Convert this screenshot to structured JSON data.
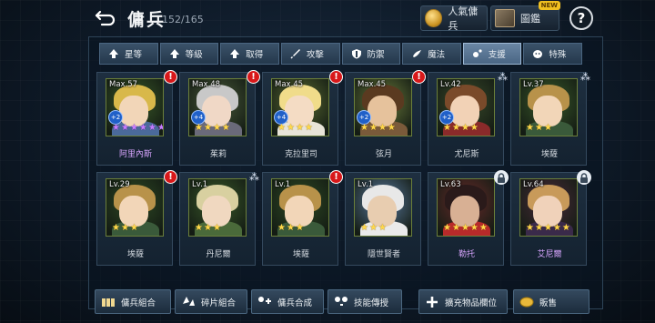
{
  "header": {
    "title": "傭兵",
    "count": "152/165",
    "popular_label": "人氣傭兵",
    "dex_label": "圖鑑",
    "new_badge": "NEW",
    "help_label": "?"
  },
  "tabs": [
    {
      "label": "星等",
      "icon": "arrow-up-icon",
      "active": false
    },
    {
      "label": "等級",
      "icon": "arrow-up-icon",
      "active": false
    },
    {
      "label": "取得",
      "icon": "arrow-up-icon",
      "active": false
    },
    {
      "label": "攻擊",
      "icon": "sword-icon",
      "active": false
    },
    {
      "label": "防禦",
      "icon": "shield-icon",
      "active": false
    },
    {
      "label": "魔法",
      "icon": "magic-icon",
      "active": false
    },
    {
      "label": "支援",
      "icon": "support-icon",
      "active": true
    },
    {
      "label": "特殊",
      "icon": "special-icon",
      "active": false
    }
  ],
  "mercenaries": [
    {
      "level": "Max.57",
      "name": "阿里內斯",
      "plus": "+2",
      "stars": 6,
      "star_color": "purple",
      "hero": true,
      "badge": "alert",
      "colors": {
        "bg": "#3a5a28",
        "hair": "#d8b84a",
        "skin": "#f2d6b8",
        "cloth": "#4a6a9a"
      }
    },
    {
      "level": "Max.48",
      "name": "茱莉",
      "plus": "+4",
      "stars": 4,
      "star_color": "gold",
      "hero": false,
      "badge": "alert",
      "colors": {
        "bg": "#4a5a3a",
        "hair": "#c8c8c8",
        "skin": "#f0d8c6",
        "cloth": "#6a6a7a"
      }
    },
    {
      "level": "Max.45",
      "name": "克拉里司",
      "plus": "+4",
      "stars": 4,
      "star_color": "gold",
      "hero": false,
      "badge": "alert",
      "colors": {
        "bg": "#5a6a32",
        "hair": "#f0dc8a",
        "skin": "#f4dcc4",
        "cloth": "#e8e4d8"
      }
    },
    {
      "level": "Max.45",
      "name": "弦月",
      "plus": "+2",
      "stars": 4,
      "star_color": "gold",
      "hero": false,
      "badge": "alert",
      "colors": {
        "bg": "#6a7a3a",
        "hair": "#5a3a20",
        "skin": "#e6c29c",
        "cloth": "#7a5a3a"
      }
    },
    {
      "level": "Lv.42",
      "name": "尤尼斯",
      "plus": "+2",
      "stars": 4,
      "star_color": "gold",
      "hero": false,
      "badge": "spark",
      "colors": {
        "bg": "#3a4a2a",
        "hair": "#7a4a2a",
        "skin": "#f2d2b6",
        "cloth": "#8a2a2a"
      }
    },
    {
      "level": "Lv.37",
      "name": "埃薩",
      "plus": "",
      "stars": 3,
      "star_color": "gold",
      "hero": false,
      "badge": "spark",
      "colors": {
        "bg": "#3a5a2a",
        "hair": "#b8924a",
        "skin": "#f2d6b8",
        "cloth": "#3a5a3a"
      }
    },
    {
      "level": "Lv.29",
      "name": "埃薩",
      "plus": "",
      "stars": 3,
      "star_color": "gold",
      "hero": false,
      "badge": "alert",
      "colors": {
        "bg": "#2e4a24",
        "hair": "#b8924a",
        "skin": "#f2d6b8",
        "cloth": "#3a5a3a"
      }
    },
    {
      "level": "Lv.1",
      "name": "丹尼爾",
      "plus": "",
      "stars": 3,
      "star_color": "gold",
      "hero": false,
      "badge": "spark",
      "colors": {
        "bg": "#3a5a2a",
        "hair": "#d8d0a0",
        "skin": "#f0d8c0",
        "cloth": "#4a6a3a"
      }
    },
    {
      "level": "Lv.1",
      "name": "埃薩",
      "plus": "",
      "stars": 3,
      "star_color": "gold",
      "hero": false,
      "badge": "alert",
      "colors": {
        "bg": "#2e4a24",
        "hair": "#b8924a",
        "skin": "#f2d6b8",
        "cloth": "#3a5a3a"
      }
    },
    {
      "level": "Lv.1",
      "name": "隱世賢者",
      "plus": "",
      "stars": 3,
      "star_color": "gold",
      "hero": false,
      "badge": "none",
      "colors": {
        "bg": "#5a7aa0",
        "hair": "#e8e8e8",
        "skin": "#e8cdb0",
        "cloth": "#eaeaea"
      }
    },
    {
      "level": "Lv.63",
      "name": "勒托",
      "plus": "",
      "stars": 5,
      "star_color": "gold",
      "hero": true,
      "badge": "lock",
      "colors": {
        "bg": "#6a2a2a",
        "hair": "#2a1a1a",
        "skin": "#d8b094",
        "cloth": "#b82a2a"
      }
    },
    {
      "level": "Lv.64",
      "name": "艾尼爾",
      "plus": "",
      "stars": 5,
      "star_color": "gold",
      "hero": true,
      "badge": "lock",
      "colors": {
        "bg": "#4a2a3a",
        "hair": "#c89a5a",
        "skin": "#f0d2ba",
        "cloth": "#3a2a4a"
      }
    }
  ],
  "bottom_bar": [
    {
      "label": "傭兵組合",
      "icon": "combo-icon"
    },
    {
      "label": "碎片組合",
      "icon": "fragment-icon"
    },
    {
      "label": "傭兵合成",
      "icon": "merge-icon"
    },
    {
      "label": "技能傳授",
      "icon": "skill-transfer-icon"
    },
    {
      "label": "擴充物品欄位",
      "icon": "plus-icon"
    },
    {
      "label": "販售",
      "icon": "gold-icon"
    }
  ]
}
